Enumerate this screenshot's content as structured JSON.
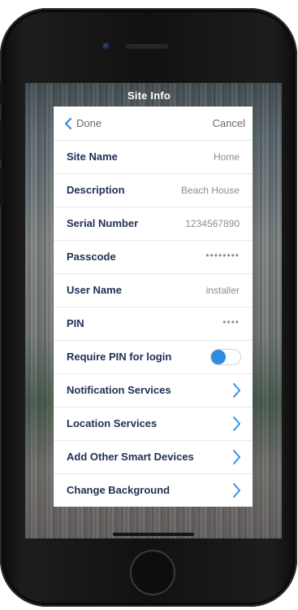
{
  "screen": {
    "title": "Site Info"
  },
  "header": {
    "done_label": "Done",
    "cancel_label": "Cancel"
  },
  "rows": {
    "site_name": {
      "label": "Site Name",
      "value": "Home"
    },
    "description": {
      "label": "Description",
      "value": "Beach House"
    },
    "serial_number": {
      "label": "Serial Number",
      "value": "1234567890"
    },
    "passcode": {
      "label": "Passcode",
      "value": "••••••••"
    },
    "user_name": {
      "label": "User Name",
      "value": "installer"
    },
    "pin": {
      "label": "PIN",
      "value": "••••"
    },
    "require_pin": {
      "label": "Require PIN for login",
      "toggle_on": false
    },
    "notification_services": {
      "label": "Notification Services"
    },
    "location_services": {
      "label": "Location Services"
    },
    "add_other_smart_devices": {
      "label": "Add Other Smart Devices"
    },
    "change_background": {
      "label": "Change Background"
    }
  },
  "icons": {
    "back": "chevron-left-icon",
    "disclosure": "chevron-right-icon"
  },
  "colors": {
    "accent": "#2d8ce0",
    "label": "#1f2f55",
    "value": "#8a8d90",
    "header_text": "#6b6b6b"
  }
}
